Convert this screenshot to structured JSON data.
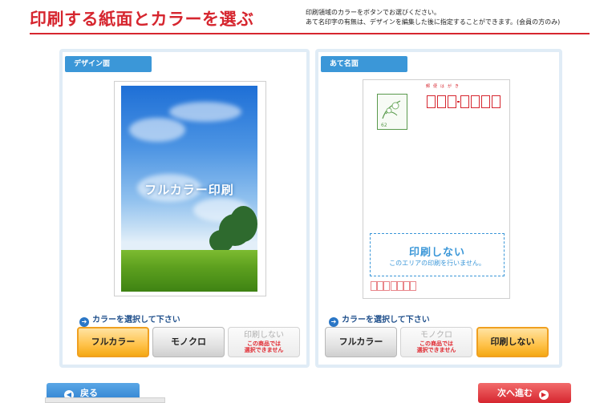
{
  "header": {
    "title": "印刷する紙面とカラーを選ぶ",
    "desc_line1": "印刷領域のカラーをボタンでお選びください。",
    "desc_line2": "あて名印字の有無は、デザインを編集した後に指定することができます。(会員の方のみ)"
  },
  "design": {
    "tab_label": "デザイン面",
    "preview_label": "フルカラー印刷",
    "prompt": "カラーを選択して下さい",
    "buttons": {
      "full_color": "フルカラー",
      "mono": "モノクロ",
      "no_print": "印刷しない",
      "no_print_note_1": "この商品では",
      "no_print_note_2": "選択できません"
    }
  },
  "address": {
    "tab_label": "あて名面",
    "postal_label": "郵便はがき",
    "noprint_title": "印刷しない",
    "noprint_sub": "このエリアの印刷を行いません。",
    "prompt": "カラーを選択して下さい",
    "buttons": {
      "full_color": "フルカラー",
      "mono": "モノクロ",
      "mono_note_1": "この商品では",
      "mono_note_2": "選択できません",
      "no_print": "印刷しない"
    }
  },
  "nav": {
    "back": "戻る",
    "next": "次へ進む"
  },
  "colors": {
    "accent_red": "#d6262f",
    "accent_blue": "#3b97d8",
    "selected_orange": "#ffc24a"
  }
}
